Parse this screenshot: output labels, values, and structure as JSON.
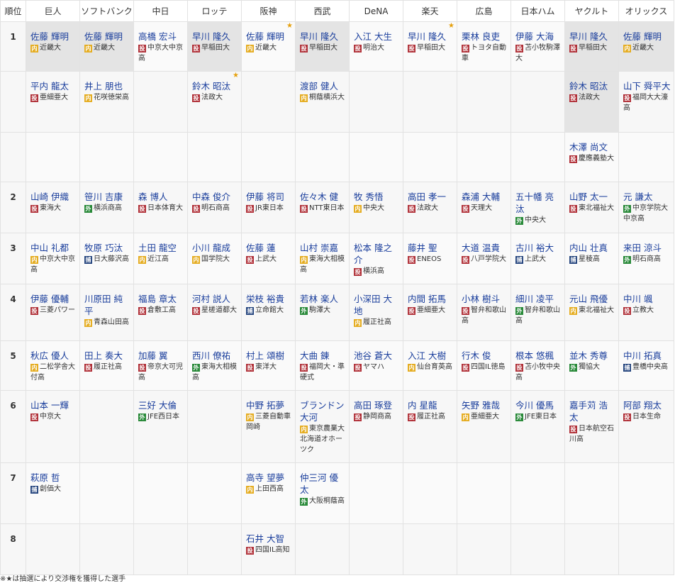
{
  "header": {
    "rank_label": "順位",
    "teams": [
      "巨人",
      "ソフトバンク",
      "中日",
      "ロッテ",
      "阪神",
      "西武",
      "DeNA",
      "楽天",
      "広島",
      "日本ハム",
      "ヤクルト",
      "オリックス"
    ]
  },
  "position_labels": {
    "p": "投",
    "i": "内",
    "o": "外",
    "c": "捕"
  },
  "footnote": "※★は抽選により交渉権を獲得した選手",
  "rows": [
    {
      "rank": "1",
      "cells": [
        {
          "picks": [
            {
              "name": "佐藤 輝明",
              "pos": "i",
              "school": "近畿大"
            }
          ],
          "highlight": true
        },
        {
          "picks": [
            {
              "name": "佐藤 輝明",
              "pos": "i",
              "school": "近畿大"
            }
          ],
          "highlight": true
        },
        {
          "picks": [
            {
              "name": "高橋 宏斗",
              "pos": "p",
              "school": "中京大中京高"
            }
          ]
        },
        {
          "picks": [
            {
              "name": "早川 隆久",
              "pos": "p",
              "school": "早稲田大"
            }
          ],
          "highlight": true
        },
        {
          "picks": [
            {
              "name": "佐藤 輝明",
              "pos": "i",
              "school": "近畿大"
            }
          ],
          "star": "★"
        },
        {
          "picks": [
            {
              "name": "早川 隆久",
              "pos": "p",
              "school": "早稲田大"
            }
          ],
          "highlight": true
        },
        {
          "picks": [
            {
              "name": "入江 大生",
              "pos": "p",
              "school": "明治大"
            }
          ]
        },
        {
          "picks": [
            {
              "name": "早川 隆久",
              "pos": "p",
              "school": "早稲田大"
            }
          ],
          "star": "★"
        },
        {
          "picks": [
            {
              "name": "栗林 良吏",
              "pos": "p",
              "school": "トヨタ自動車"
            }
          ]
        },
        {
          "picks": [
            {
              "name": "伊藤 大海",
              "pos": "p",
              "school": "苫小牧駒澤大"
            }
          ]
        },
        {
          "picks": [
            {
              "name": "早川 隆久",
              "pos": "p",
              "school": "早稲田大"
            }
          ],
          "highlight": true
        },
        {
          "picks": [
            {
              "name": "佐藤 輝明",
              "pos": "i",
              "school": "近畿大"
            }
          ],
          "highlight": true
        }
      ]
    },
    {
      "rank": "",
      "cells": [
        {
          "picks": [
            {
              "name": "平内 龍太",
              "pos": "p",
              "school": "亜細亜大"
            }
          ]
        },
        {
          "picks": [
            {
              "name": "井上 朋也",
              "pos": "i",
              "school": "花咲徳栄高"
            }
          ]
        },
        {
          "picks": []
        },
        {
          "picks": [
            {
              "name": "鈴木 昭汰",
              "pos": "p",
              "school": "法政大"
            }
          ],
          "star": "★"
        },
        {
          "picks": []
        },
        {
          "picks": [
            {
              "name": "渡部 健人",
              "pos": "i",
              "school": "桐蔭横浜大"
            }
          ]
        },
        {
          "picks": []
        },
        {
          "picks": []
        },
        {
          "picks": []
        },
        {
          "picks": []
        },
        {
          "picks": [
            {
              "name": "鈴木 昭汰",
              "pos": "p",
              "school": "法政大"
            }
          ],
          "highlight": true
        },
        {
          "picks": [
            {
              "name": "山下 舜平大",
              "pos": "p",
              "school": "福岡大大濠高"
            }
          ]
        }
      ]
    },
    {
      "rank": "",
      "cells": [
        {
          "picks": []
        },
        {
          "picks": []
        },
        {
          "picks": []
        },
        {
          "picks": []
        },
        {
          "picks": []
        },
        {
          "picks": []
        },
        {
          "picks": []
        },
        {
          "picks": []
        },
        {
          "picks": []
        },
        {
          "picks": []
        },
        {
          "picks": [
            {
              "name": "木澤 尚文",
              "pos": "p",
              "school": "慶應義塾大"
            }
          ]
        },
        {
          "picks": []
        }
      ]
    },
    {
      "rank": "2",
      "cells": [
        {
          "picks": [
            {
              "name": "山崎 伊織",
              "pos": "p",
              "school": "東海大"
            }
          ]
        },
        {
          "picks": [
            {
              "name": "笹川 吉康",
              "pos": "o",
              "school": "横浜商高"
            }
          ]
        },
        {
          "picks": [
            {
              "name": "森 博人",
              "pos": "p",
              "school": "日本体育大"
            }
          ]
        },
        {
          "picks": [
            {
              "name": "中森 俊介",
              "pos": "p",
              "school": "明石商高"
            }
          ]
        },
        {
          "picks": [
            {
              "name": "伊藤 将司",
              "pos": "p",
              "school": "JR東日本"
            }
          ]
        },
        {
          "picks": [
            {
              "name": "佐々木 健",
              "pos": "p",
              "school": "NTT東日本"
            }
          ]
        },
        {
          "picks": [
            {
              "name": "牧 秀悟",
              "pos": "i",
              "school": "中央大"
            }
          ]
        },
        {
          "picks": [
            {
              "name": "高田 孝一",
              "pos": "p",
              "school": "法政大"
            }
          ]
        },
        {
          "picks": [
            {
              "name": "森浦 大輔",
              "pos": "p",
              "school": "天理大"
            }
          ]
        },
        {
          "picks": [
            {
              "name": "五十幡 亮汰",
              "pos": "o",
              "school": "中央大"
            }
          ]
        },
        {
          "picks": [
            {
              "name": "山野 太一",
              "pos": "p",
              "school": "東北福祉大"
            }
          ]
        },
        {
          "picks": [
            {
              "name": "元 謙太",
              "pos": "o",
              "school": "中京学院大中京高"
            }
          ]
        }
      ]
    },
    {
      "rank": "3",
      "cells": [
        {
          "picks": [
            {
              "name": "中山 礼都",
              "pos": "i",
              "school": "中京大中京高"
            }
          ]
        },
        {
          "picks": [
            {
              "name": "牧原 巧汰",
              "pos": "c",
              "school": "日大藤沢高"
            }
          ]
        },
        {
          "picks": [
            {
              "name": "土田 龍空",
              "pos": "i",
              "school": "近江高"
            }
          ]
        },
        {
          "picks": [
            {
              "name": "小川 龍成",
              "pos": "i",
              "school": "国学院大"
            }
          ]
        },
        {
          "picks": [
            {
              "name": "佐藤 蓮",
              "pos": "p",
              "school": "上武大"
            }
          ]
        },
        {
          "picks": [
            {
              "name": "山村 崇嘉",
              "pos": "i",
              "school": "東海大相模高"
            }
          ]
        },
        {
          "picks": [
            {
              "name": "松本 隆之介",
              "pos": "p",
              "school": "横浜高"
            }
          ]
        },
        {
          "picks": [
            {
              "name": "藤井 聖",
              "pos": "p",
              "school": "ENEOS"
            }
          ]
        },
        {
          "picks": [
            {
              "name": "大道 温貴",
              "pos": "p",
              "school": "八戸学院大"
            }
          ]
        },
        {
          "picks": [
            {
              "name": "古川 裕大",
              "pos": "c",
              "school": "上武大"
            }
          ]
        },
        {
          "picks": [
            {
              "name": "内山 壮真",
              "pos": "c",
              "school": "星稜高"
            }
          ]
        },
        {
          "picks": [
            {
              "name": "来田 涼斗",
              "pos": "o",
              "school": "明石商高"
            }
          ]
        }
      ]
    },
    {
      "rank": "4",
      "cells": [
        {
          "picks": [
            {
              "name": "伊藤 優輔",
              "pos": "p",
              "school": "三菱パワー"
            }
          ]
        },
        {
          "picks": [
            {
              "name": "川原田 純平",
              "pos": "i",
              "school": "青森山田高"
            }
          ]
        },
        {
          "picks": [
            {
              "name": "福島 章太",
              "pos": "p",
              "school": "倉敷工高"
            }
          ]
        },
        {
          "picks": [
            {
              "name": "河村 説人",
              "pos": "p",
              "school": "星槎道都大"
            }
          ]
        },
        {
          "picks": [
            {
              "name": "栄枝 裕貴",
              "pos": "c",
              "school": "立命館大"
            }
          ]
        },
        {
          "picks": [
            {
              "name": "若林 楽人",
              "pos": "o",
              "school": "駒澤大"
            }
          ]
        },
        {
          "picks": [
            {
              "name": "小深田 大地",
              "pos": "i",
              "school": "履正社高"
            }
          ]
        },
        {
          "picks": [
            {
              "name": "内間 拓馬",
              "pos": "p",
              "school": "亜細亜大"
            }
          ]
        },
        {
          "picks": [
            {
              "name": "小林 樹斗",
              "pos": "p",
              "school": "智弁和歌山高"
            }
          ]
        },
        {
          "picks": [
            {
              "name": "細川 凌平",
              "pos": "o",
              "school": "智弁和歌山高"
            }
          ]
        },
        {
          "picks": [
            {
              "name": "元山 飛優",
              "pos": "i",
              "school": "東北福祉大"
            }
          ]
        },
        {
          "picks": [
            {
              "name": "中川 颯",
              "pos": "p",
              "school": "立教大"
            }
          ]
        }
      ]
    },
    {
      "rank": "5",
      "cells": [
        {
          "picks": [
            {
              "name": "秋広 優人",
              "pos": "i",
              "school": "二松学舎大付高"
            }
          ]
        },
        {
          "picks": [
            {
              "name": "田上 奏大",
              "pos": "p",
              "school": "履正社高"
            }
          ]
        },
        {
          "picks": [
            {
              "name": "加藤 翼",
              "pos": "p",
              "school": "帝京大可児高"
            }
          ]
        },
        {
          "picks": [
            {
              "name": "西川 僚祐",
              "pos": "o",
              "school": "東海大相模高"
            }
          ]
        },
        {
          "picks": [
            {
              "name": "村上 頌樹",
              "pos": "p",
              "school": "東洋大"
            }
          ]
        },
        {
          "picks": [
            {
              "name": "大曲 錬",
              "pos": "p",
              "school": "福岡大・準硬式"
            }
          ]
        },
        {
          "picks": [
            {
              "name": "池谷 蒼大",
              "pos": "p",
              "school": "ヤマハ"
            }
          ]
        },
        {
          "picks": [
            {
              "name": "入江 大樹",
              "pos": "i",
              "school": "仙台育英高"
            }
          ]
        },
        {
          "picks": [
            {
              "name": "行木 俊",
              "pos": "p",
              "school": "四国IL徳島"
            }
          ]
        },
        {
          "picks": [
            {
              "name": "根本 悠楓",
              "pos": "p",
              "school": "苫小牧中央高"
            }
          ]
        },
        {
          "picks": [
            {
              "name": "並木 秀尊",
              "pos": "o",
              "school": "獨協大"
            }
          ]
        },
        {
          "picks": [
            {
              "name": "中川 拓真",
              "pos": "c",
              "school": "豊橋中央高"
            }
          ]
        }
      ]
    },
    {
      "rank": "6",
      "cells": [
        {
          "picks": [
            {
              "name": "山本 一輝",
              "pos": "p",
              "school": "中京大"
            }
          ]
        },
        {
          "picks": []
        },
        {
          "picks": [
            {
              "name": "三好 大倫",
              "pos": "o",
              "school": "JFE西日本"
            }
          ]
        },
        {
          "picks": []
        },
        {
          "picks": [
            {
              "name": "中野 拓夢",
              "pos": "i",
              "school": "三菱自動車岡崎"
            }
          ]
        },
        {
          "picks": [
            {
              "name": "ブランドン 大河",
              "pos": "i",
              "school": "東京農業大北海道オホーツク"
            }
          ]
        },
        {
          "picks": [
            {
              "name": "高田 琢登",
              "pos": "p",
              "school": "静岡商高"
            }
          ]
        },
        {
          "picks": [
            {
              "name": "内 星龍",
              "pos": "p",
              "school": "履正社高"
            }
          ]
        },
        {
          "picks": [
            {
              "name": "矢野 雅哉",
              "pos": "i",
              "school": "亜細亜大"
            }
          ]
        },
        {
          "picks": [
            {
              "name": "今川 優馬",
              "pos": "o",
              "school": "JFE東日本"
            }
          ]
        },
        {
          "picks": [
            {
              "name": "嘉手苅 浩太",
              "pos": "p",
              "school": "日本航空石川高"
            }
          ]
        },
        {
          "picks": [
            {
              "name": "阿部 翔太",
              "pos": "p",
              "school": "日本生命"
            }
          ]
        }
      ]
    },
    {
      "rank": "7",
      "cells": [
        {
          "picks": [
            {
              "name": "萩原 哲",
              "pos": "c",
              "school": "創価大"
            }
          ]
        },
        {
          "picks": []
        },
        {
          "picks": []
        },
        {
          "picks": []
        },
        {
          "picks": [
            {
              "name": "高寺 望夢",
              "pos": "i",
              "school": "上田西高"
            }
          ]
        },
        {
          "picks": [
            {
              "name": "仲三河 優太",
              "pos": "o",
              "school": "大阪桐蔭高"
            }
          ]
        },
        {
          "picks": []
        },
        {
          "picks": []
        },
        {
          "picks": []
        },
        {
          "picks": []
        },
        {
          "picks": []
        },
        {
          "picks": []
        }
      ]
    },
    {
      "rank": "8",
      "cells": [
        {
          "picks": []
        },
        {
          "picks": []
        },
        {
          "picks": []
        },
        {
          "picks": []
        },
        {
          "picks": [
            {
              "name": "石井 大智",
              "pos": "p",
              "school": "四国IL高知"
            }
          ]
        },
        {
          "picks": []
        },
        {
          "picks": []
        },
        {
          "picks": []
        },
        {
          "picks": []
        },
        {
          "picks": []
        },
        {
          "picks": []
        },
        {
          "picks": []
        }
      ]
    }
  ]
}
